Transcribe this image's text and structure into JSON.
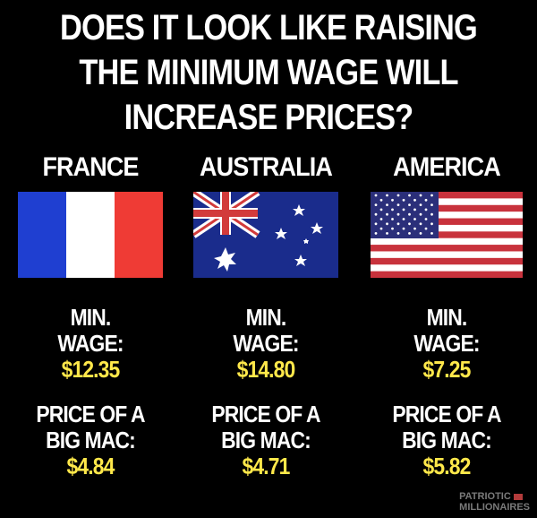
{
  "headline": {
    "lines": [
      "DOES IT LOOK LIKE RAISING",
      "THE MINIMUM WAGE WILL",
      "INCREASE PRICES?"
    ]
  },
  "countries": [
    {
      "name": "FRANCE",
      "wage_label_1": "MIN.",
      "wage_label_2": "WAGE:",
      "wage_value": "$12.35",
      "price_label_1": "PRICE OF A",
      "price_label_2": "BIG MAC:",
      "price_value": "$4.84"
    },
    {
      "name": "AUSTRALIA",
      "wage_label_1": "MIN.",
      "wage_label_2": "WAGE:",
      "wage_value": "$14.80",
      "price_label_1": "PRICE OF A",
      "price_label_2": "BIG MAC:",
      "price_value": "$4.71"
    },
    {
      "name": "AMERICA",
      "wage_label_1": "MIN.",
      "wage_label_2": "WAGE:",
      "wage_value": "$7.25",
      "price_label_1": "PRICE OF A",
      "price_label_2": "BIG MAC:",
      "price_value": "$5.82"
    }
  ],
  "brand": {
    "line1": "PATRIOTIC",
    "line2": "MILLIONAIRES"
  },
  "colors": {
    "background": "#000000",
    "text": "#ffffff",
    "value_highlight": "#ffe84a",
    "france_blue": "#1f3fd1",
    "france_white": "#ffffff",
    "france_red": "#ef3b35",
    "australia_blue": "#1a2c8c",
    "us_red": "#c8323c",
    "us_blue": "#2b2f7a"
  },
  "icons": {
    "france": "france-flag-icon",
    "australia": "australia-flag-icon",
    "america": "usa-flag-icon"
  }
}
